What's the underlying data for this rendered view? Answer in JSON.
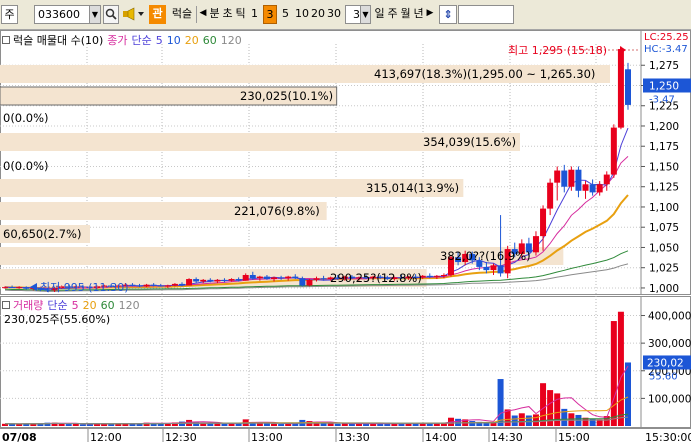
{
  "toolbar": {
    "market": "주",
    "code": "033600",
    "tag1": "관",
    "name": "럭슬",
    "nav_left": "◀",
    "period": "분",
    "tick": "초",
    "tick2": "틱",
    "intervals": [
      "1",
      "3",
      "5",
      "10",
      "20",
      "30"
    ],
    "interval_selected": "3",
    "count_value": "3",
    "periods": [
      "일",
      "주",
      "월",
      "년"
    ],
    "nav_right": "▶",
    "updown": "⇕"
  },
  "colors": {
    "up": "#e8001c",
    "down": "#1c56d6",
    "ma5": "#4d40d9",
    "ma10": "#d62c9e",
    "ma20": "#e8a010",
    "ma60": "#2f8a3a",
    "ma120": "#8a8a8a",
    "zone": "#f4e4d0",
    "hline": "#d47272"
  },
  "price_legend": {
    "title": "럭슬 매물대 수(10)",
    "items": [
      "종가",
      "단순",
      "5",
      "10",
      "20",
      "60",
      "120"
    ]
  },
  "price_axis": {
    "ticks": [
      "1,275",
      "1,250",
      "1,225",
      "1,200",
      "1,175",
      "1,150",
      "1,125",
      "1,100",
      "1,075",
      "1,050",
      "1,025",
      "1,000"
    ],
    "current_price": "1,250",
    "current_change": "-3.47",
    "lc_label": "LC:25.25",
    "hc_label": "HC:-3.47"
  },
  "volume_profile": [
    {
      "label": "413,697(18.3%)(1,295.00 ~ 1,265.30)",
      "ratio": 0.183
    },
    {
      "label": "230,025(10.1%)",
      "ratio": 0.101
    },
    {
      "label": "0(0.0%)",
      "ratio": 0
    },
    {
      "label": "354,039(15.6%)",
      "ratio": 0.156
    },
    {
      "label": "0(0.0%)",
      "ratio": 0
    },
    {
      "label": "315,014(13.9%)",
      "ratio": 0.139
    },
    {
      "label": "221,076(9.8%)",
      "ratio": 0.098
    },
    {
      "label": "60,650(2.7%)",
      "ratio": 0.027
    },
    {
      "label": "382,0??(16.9%)",
      "ratio": 0.169
    },
    {
      "label": "290,25?(12.8%)",
      "ratio": 0.128
    }
  ],
  "annotations": {
    "high": "최고 1,295 (15:18)",
    "low": "최저 995 (11:30)"
  },
  "volume_legend": {
    "title": "거래량",
    "items": [
      "단순",
      "5",
      "20",
      "60",
      "120"
    ],
    "current": "230,025주(55.60%)"
  },
  "volume_axis": {
    "ticks": [
      "400,000",
      "300,000",
      "200,000",
      "100,000"
    ],
    "current_value": "230,02",
    "current_pct": "55.60"
  },
  "time_axis": {
    "labels": [
      "07/08",
      "12:00",
      "12:30",
      "13:00",
      "13:30",
      "14:00",
      "14:30",
      "15:00",
      "15:30:00"
    ]
  },
  "chart_data": {
    "type": "candlestick",
    "interval": "3분",
    "price_ylim": [
      995,
      1300
    ],
    "volume_ylim": [
      0,
      420000
    ],
    "candles": [
      {
        "o": 1000,
        "h": 1002,
        "l": 999,
        "c": 1001,
        "v": 8000
      },
      {
        "o": 1001,
        "h": 1003,
        "l": 1000,
        "c": 1000,
        "v": 9000
      },
      {
        "o": 1000,
        "h": 1002,
        "l": 999,
        "c": 1001,
        "v": 6000
      },
      {
        "o": 1001,
        "h": 1002,
        "l": 998,
        "c": 999,
        "v": 9000
      },
      {
        "o": 999,
        "h": 1001,
        "l": 997,
        "c": 1000,
        "v": 8000
      },
      {
        "o": 1000,
        "h": 1001,
        "l": 996,
        "c": 998,
        "v": 10000
      },
      {
        "o": 998,
        "h": 1000,
        "l": 995,
        "c": 997,
        "v": 12000
      },
      {
        "o": 997,
        "h": 1001,
        "l": 995,
        "c": 1000,
        "v": 12000
      },
      {
        "o": 1000,
        "h": 1003,
        "l": 999,
        "c": 1002,
        "v": 9000
      },
      {
        "o": 1002,
        "h": 1004,
        "l": 1000,
        "c": 1001,
        "v": 7000
      },
      {
        "o": 1001,
        "h": 1003,
        "l": 999,
        "c": 1002,
        "v": 8000
      },
      {
        "o": 1002,
        "h": 1004,
        "l": 1000,
        "c": 1001,
        "v": 6000
      },
      {
        "o": 1001,
        "h": 1002,
        "l": 999,
        "c": 1000,
        "v": 7000
      },
      {
        "o": 1000,
        "h": 1003,
        "l": 999,
        "c": 1002,
        "v": 9000
      },
      {
        "o": 1002,
        "h": 1004,
        "l": 1001,
        "c": 1003,
        "v": 8000
      },
      {
        "o": 1003,
        "h": 1005,
        "l": 1001,
        "c": 1002,
        "v": 7000
      },
      {
        "o": 1002,
        "h": 1004,
        "l": 1000,
        "c": 1003,
        "v": 9000
      },
      {
        "o": 1003,
        "h": 1006,
        "l": 1002,
        "c": 1004,
        "v": 10000
      },
      {
        "o": 1004,
        "h": 1006,
        "l": 1002,
        "c": 1003,
        "v": 8000
      },
      {
        "o": 1003,
        "h": 1005,
        "l": 1001,
        "c": 1002,
        "v": 9000
      },
      {
        "o": 1002,
        "h": 1005,
        "l": 1001,
        "c": 1004,
        "v": 12000
      },
      {
        "o": 1004,
        "h": 1006,
        "l": 1002,
        "c": 1003,
        "v": 11000
      },
      {
        "o": 1003,
        "h": 1005,
        "l": 1001,
        "c": 1002,
        "v": 10000
      },
      {
        "o": 1002,
        "h": 1004,
        "l": 1000,
        "c": 1003,
        "v": 9000
      },
      {
        "o": 1003,
        "h": 1006,
        "l": 1002,
        "c": 1005,
        "v": 13000
      },
      {
        "o": 1005,
        "h": 1007,
        "l": 1002,
        "c": 1003,
        "v": 16000
      },
      {
        "o": 1003,
        "h": 1012,
        "l": 1003,
        "c": 1011,
        "v": 22000
      },
      {
        "o": 1011,
        "h": 1013,
        "l": 1006,
        "c": 1008,
        "v": 14000
      },
      {
        "o": 1008,
        "h": 1011,
        "l": 1006,
        "c": 1010,
        "v": 11000
      },
      {
        "o": 1010,
        "h": 1012,
        "l": 1007,
        "c": 1008,
        "v": 9000
      },
      {
        "o": 1008,
        "h": 1011,
        "l": 1006,
        "c": 1010,
        "v": 10000
      },
      {
        "o": 1010,
        "h": 1012,
        "l": 1007,
        "c": 1009,
        "v": 8000
      },
      {
        "o": 1009,
        "h": 1012,
        "l": 1008,
        "c": 1011,
        "v": 9000
      },
      {
        "o": 1011,
        "h": 1013,
        "l": 1008,
        "c": 1009,
        "v": 11000
      },
      {
        "o": 1009,
        "h": 1018,
        "l": 1009,
        "c": 1016,
        "v": 24000
      },
      {
        "o": 1016,
        "h": 1020,
        "l": 1010,
        "c": 1012,
        "v": 14000
      },
      {
        "o": 1012,
        "h": 1015,
        "l": 1009,
        "c": 1014,
        "v": 10000
      },
      {
        "o": 1014,
        "h": 1016,
        "l": 1010,
        "c": 1011,
        "v": 9000
      },
      {
        "o": 1011,
        "h": 1014,
        "l": 1008,
        "c": 1013,
        "v": 8000
      },
      {
        "o": 1013,
        "h": 1015,
        "l": 1010,
        "c": 1012,
        "v": 7000
      },
      {
        "o": 1012,
        "h": 1015,
        "l": 1009,
        "c": 1014,
        "v": 9000
      },
      {
        "o": 1014,
        "h": 1017,
        "l": 1011,
        "c": 1012,
        "v": 10000
      },
      {
        "o": 1012,
        "h": 1014,
        "l": 1002,
        "c": 1003,
        "v": 22000
      },
      {
        "o": 1003,
        "h": 1011,
        "l": 1002,
        "c": 1010,
        "v": 18000
      },
      {
        "o": 1010,
        "h": 1014,
        "l": 1008,
        "c": 1012,
        "v": 13000
      },
      {
        "o": 1012,
        "h": 1015,
        "l": 1009,
        "c": 1011,
        "v": 10000
      },
      {
        "o": 1011,
        "h": 1014,
        "l": 1009,
        "c": 1013,
        "v": 9000
      },
      {
        "o": 1013,
        "h": 1016,
        "l": 1010,
        "c": 1012,
        "v": 8000
      },
      {
        "o": 1012,
        "h": 1015,
        "l": 1009,
        "c": 1014,
        "v": 9000
      },
      {
        "o": 1014,
        "h": 1016,
        "l": 1011,
        "c": 1012,
        "v": 8000
      },
      {
        "o": 1012,
        "h": 1014,
        "l": 1009,
        "c": 1013,
        "v": 9000
      },
      {
        "o": 1013,
        "h": 1016,
        "l": 1011,
        "c": 1012,
        "v": 10000
      },
      {
        "o": 1012,
        "h": 1015,
        "l": 1010,
        "c": 1014,
        "v": 8000
      },
      {
        "o": 1014,
        "h": 1016,
        "l": 1011,
        "c": 1013,
        "v": 9000
      },
      {
        "o": 1013,
        "h": 1015,
        "l": 1010,
        "c": 1011,
        "v": 8000
      },
      {
        "o": 1011,
        "h": 1014,
        "l": 1009,
        "c": 1013,
        "v": 9000
      },
      {
        "o": 1013,
        "h": 1016,
        "l": 1011,
        "c": 1012,
        "v": 10000
      },
      {
        "o": 1012,
        "h": 1015,
        "l": 1010,
        "c": 1014,
        "v": 9000
      },
      {
        "o": 1014,
        "h": 1017,
        "l": 1011,
        "c": 1013,
        "v": 10000
      },
      {
        "o": 1013,
        "h": 1016,
        "l": 1011,
        "c": 1015,
        "v": 11000
      },
      {
        "o": 1015,
        "h": 1018,
        "l": 1012,
        "c": 1014,
        "v": 9000
      },
      {
        "o": 1014,
        "h": 1016,
        "l": 1011,
        "c": 1015,
        "v": 10000
      },
      {
        "o": 1015,
        "h": 1018,
        "l": 1012,
        "c": 1016,
        "v": 12000
      },
      {
        "o": 1016,
        "h": 1040,
        "l": 1014,
        "c": 1038,
        "v": 30000
      },
      {
        "o": 1038,
        "h": 1044,
        "l": 1028,
        "c": 1032,
        "v": 26000
      },
      {
        "o": 1032,
        "h": 1046,
        "l": 1028,
        "c": 1042,
        "v": 24000
      },
      {
        "o": 1042,
        "h": 1045,
        "l": 1030,
        "c": 1034,
        "v": 18000
      },
      {
        "o": 1034,
        "h": 1038,
        "l": 1022,
        "c": 1026,
        "v": 15000
      },
      {
        "o": 1026,
        "h": 1032,
        "l": 1018,
        "c": 1022,
        "v": 14000
      },
      {
        "o": 1022,
        "h": 1030,
        "l": 1016,
        "c": 1028,
        "v": 13000
      },
      {
        "o": 1028,
        "h": 1090,
        "l": 1014,
        "c": 1018,
        "v": 170000
      },
      {
        "o": 1018,
        "h": 1052,
        "l": 1012,
        "c": 1048,
        "v": 60000
      },
      {
        "o": 1048,
        "h": 1056,
        "l": 1038,
        "c": 1042,
        "v": 38000
      },
      {
        "o": 1042,
        "h": 1060,
        "l": 1036,
        "c": 1055,
        "v": 46000
      },
      {
        "o": 1055,
        "h": 1062,
        "l": 1040,
        "c": 1044,
        "v": 38000
      },
      {
        "o": 1044,
        "h": 1070,
        "l": 1040,
        "c": 1064,
        "v": 42000
      },
      {
        "o": 1064,
        "h": 1102,
        "l": 1046,
        "c": 1098,
        "v": 155000
      },
      {
        "o": 1098,
        "h": 1135,
        "l": 1090,
        "c": 1130,
        "v": 130000
      },
      {
        "o": 1130,
        "h": 1150,
        "l": 1108,
        "c": 1145,
        "v": 118000
      },
      {
        "o": 1145,
        "h": 1152,
        "l": 1118,
        "c": 1125,
        "v": 62000
      },
      {
        "o": 1125,
        "h": 1150,
        "l": 1120,
        "c": 1146,
        "v": 46000
      },
      {
        "o": 1146,
        "h": 1150,
        "l": 1112,
        "c": 1120,
        "v": 40000
      },
      {
        "o": 1120,
        "h": 1132,
        "l": 1110,
        "c": 1128,
        "v": 30000
      },
      {
        "o": 1128,
        "h": 1134,
        "l": 1114,
        "c": 1118,
        "v": 26000
      },
      {
        "o": 1118,
        "h": 1132,
        "l": 1114,
        "c": 1128,
        "v": 24000
      },
      {
        "o": 1128,
        "h": 1144,
        "l": 1120,
        "c": 1140,
        "v": 36000
      },
      {
        "o": 1140,
        "h": 1202,
        "l": 1136,
        "c": 1198,
        "v": 380000
      },
      {
        "o": 1198,
        "h": 1298,
        "l": 1196,
        "c": 1295,
        "v": 413697
      },
      {
        "o": 1270,
        "h": 1278,
        "l": 1220,
        "c": 1226,
        "v": 230025
      }
    ]
  }
}
